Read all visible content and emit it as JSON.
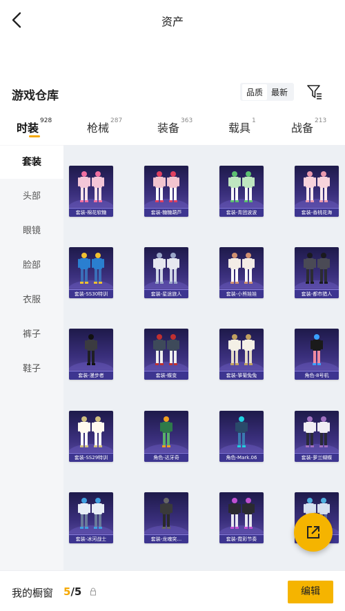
{
  "header": {
    "title": "资产"
  },
  "warehouse": {
    "title": "游戏仓库",
    "sort_options": [
      "品质",
      "最新"
    ]
  },
  "tabs": [
    {
      "label": "时装",
      "count": "928"
    },
    {
      "label": "枪械",
      "count": "287"
    },
    {
      "label": "装备",
      "count": "363"
    },
    {
      "label": "载具",
      "count": "1"
    },
    {
      "label": "战备",
      "count": "213"
    }
  ],
  "sidebar": {
    "items": [
      "套装",
      "头部",
      "眼镜",
      "脸部",
      "衣服",
      "裤子",
      "鞋子"
    ]
  },
  "items": [
    "套装-棉花软糖",
    "套装-糖糖葫芦",
    "套装-青团波波",
    "套装-香桃花海",
    "套装-SS30特训",
    "套装-星途旅人",
    "套装-小熊娃娃",
    "套装-都市猎人",
    "套装-漫步者",
    "套装-蝶变",
    "套装-箏菊兔兔",
    "角色-8号机",
    "套装-SS29特训",
    "角色-达牙奇",
    "角色-Mark.06",
    "套装-萝兰蝴蝶",
    "套装-冰河战士",
    "套装-龙魂突…",
    "套装-霓彩节奏",
    "套装-…"
  ],
  "bottom": {
    "label": "我的橱窗",
    "current": "5",
    "total": "/5",
    "edit_label": "编辑"
  },
  "colors": {
    "accent": "#f5b400",
    "card_bg": "#3a2f7c"
  }
}
